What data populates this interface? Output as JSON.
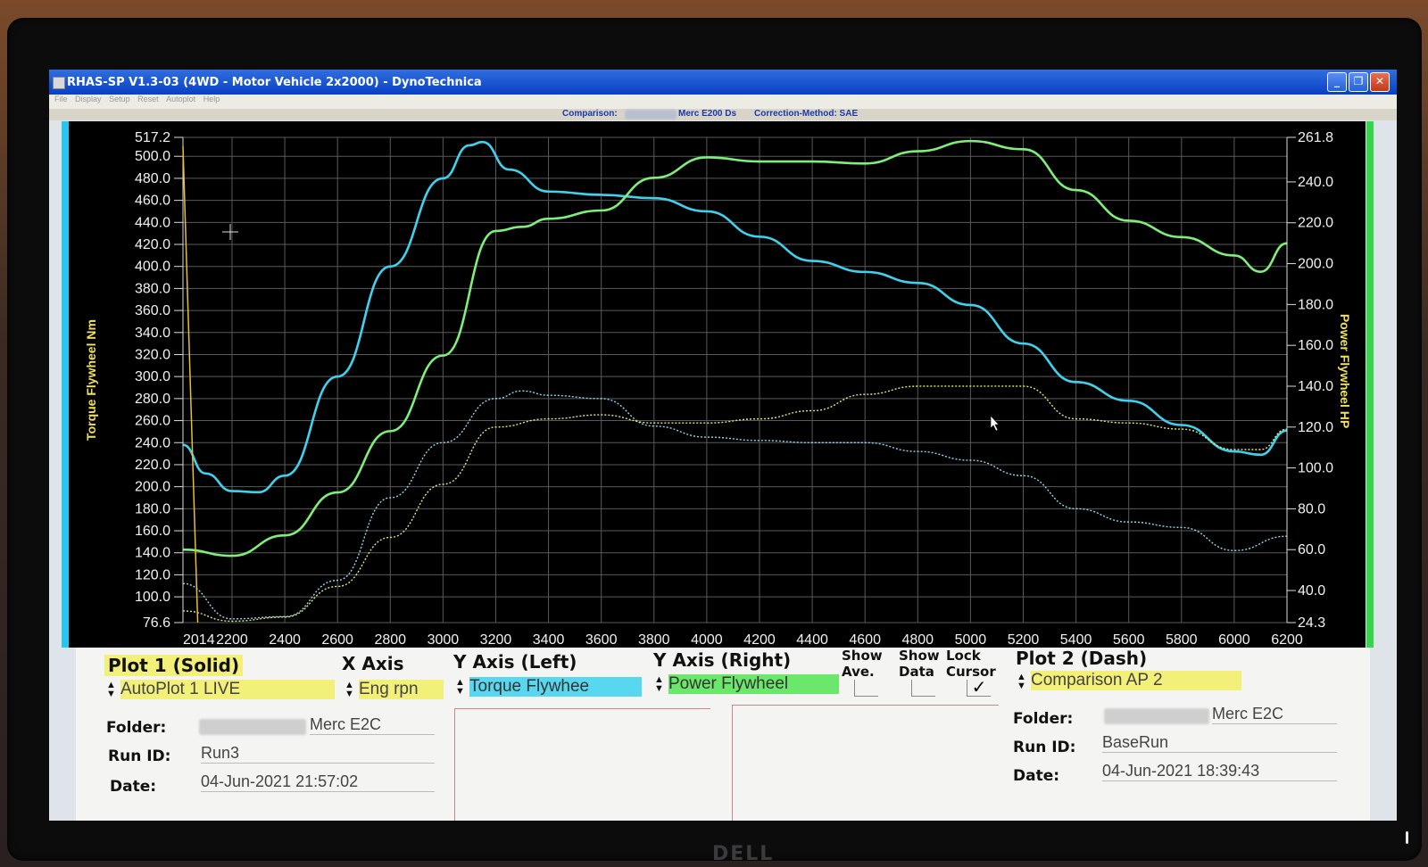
{
  "window": {
    "title": "RHAS-SP V1.3-03  (4WD - Motor Vehicle 2x2000) - DynoTechnica",
    "menu": [
      "File",
      "Display",
      "Setup",
      "Reset",
      "Autoplot",
      "Help"
    ],
    "buttons": {
      "minimize": "_",
      "restore": "❐",
      "close": "✕"
    }
  },
  "infobar": {
    "comparison_label": "Comparison:",
    "comparison_value": "Merc E200 Ds",
    "correction": "Correction-Method: SAE"
  },
  "chart_data": {
    "type": "line",
    "ylabel_left": "Torque Flywheel Nm",
    "ylabel_right": "Power Flywheel HP",
    "xlim": [
      2014,
      6200
    ],
    "ylim_left": [
      76.6,
      517.2
    ],
    "ylim_right": [
      24.3,
      261.8
    ],
    "x_ticks": [
      "2014",
      "2200",
      "2400",
      "2600",
      "2800",
      "3000",
      "3200",
      "3400",
      "3600",
      "3800",
      "4000",
      "4200",
      "4400",
      "4600",
      "4800",
      "5000",
      "5200",
      "5400",
      "5600",
      "5800",
      "6000",
      "6200"
    ],
    "y_left_ticks": [
      "517.2",
      "500.0",
      "480.0",
      "460.0",
      "440.0",
      "420.0",
      "400.0",
      "380.0",
      "360.0",
      "340.0",
      "320.0",
      "300.0",
      "280.0",
      "260.0",
      "240.0",
      "220.0",
      "200.0",
      "180.0",
      "160.0",
      "140.0",
      "120.0",
      "100.0",
      "76.6"
    ],
    "y_right_ticks": [
      "261.8",
      "240.0",
      "220.0",
      "200.0",
      "180.0",
      "160.0",
      "140.0",
      "120.0",
      "100.0",
      "80.0",
      "60.0",
      "40.0",
      "24.3"
    ],
    "grid": true,
    "series": [
      {
        "name": "Torque Flywheel",
        "plot": "AutoPlot 1 LIVE",
        "style": "solid",
        "color": "#3ed2ee",
        "x": [
          2014,
          2100,
          2200,
          2300,
          2400,
          2600,
          2800,
          3000,
          3100,
          3150,
          3250,
          3400,
          3600,
          3800,
          4000,
          4200,
          4400,
          4600,
          4800,
          5000,
          5200,
          5400,
          5600,
          5800,
          6000,
          6100,
          6200
        ],
        "y": [
          238,
          212,
          196,
          195,
          210,
          300,
          400,
          480,
          510,
          513,
          488,
          468,
          465,
          462,
          450,
          427,
          405,
          395,
          385,
          365,
          330,
          295,
          278,
          256,
          232,
          229,
          251
        ]
      },
      {
        "name": "Power Flywheel",
        "plot": "AutoPlot 1 LIVE",
        "style": "solid",
        "color": "#7ef07a",
        "x": [
          2014,
          2200,
          2400,
          2600,
          2800,
          3000,
          3200,
          3300,
          3400,
          3600,
          3800,
          4000,
          4200,
          4400,
          4600,
          4800,
          5000,
          5200,
          5400,
          5600,
          5800,
          6000,
          6100,
          6200
        ],
        "y": [
          60,
          57,
          67,
          88,
          118,
          155,
          216,
          218,
          222,
          226,
          242,
          252,
          250,
          250,
          249,
          255,
          260,
          256,
          236,
          221,
          213,
          204,
          196,
          210
        ]
      },
      {
        "name": "Torque Flywheel",
        "plot": "Comparison AP 2",
        "style": "dash",
        "color": "#8fd8ee",
        "x": [
          2014,
          2200,
          2400,
          2600,
          2800,
          3000,
          3200,
          3300,
          3400,
          3600,
          3800,
          4000,
          4200,
          4400,
          4600,
          4800,
          5000,
          5200,
          5400,
          5600,
          5800,
          6000,
          6200
        ],
        "y": [
          112,
          80,
          82,
          115,
          190,
          240,
          280,
          287,
          283,
          280,
          255,
          245,
          242,
          240,
          240,
          232,
          224,
          210,
          180,
          168,
          163,
          142,
          155
        ]
      },
      {
        "name": "Power Flywheel",
        "plot": "Comparison AP 2",
        "style": "dash",
        "color": "#e0e87a",
        "x": [
          2014,
          2200,
          2400,
          2600,
          2800,
          3000,
          3200,
          3400,
          3600,
          3800,
          4000,
          4200,
          4400,
          4600,
          4800,
          5000,
          5200,
          5400,
          5600,
          5800,
          6000,
          6100,
          6200
        ],
        "y": [
          30,
          25,
          27,
          42,
          66,
          92,
          120,
          124,
          126,
          122,
          122,
          124,
          128,
          136,
          140,
          140,
          140,
          124,
          122,
          119,
          109,
          109,
          119
        ]
      }
    ]
  },
  "controls": {
    "plot1_title": "Plot 1 (Solid)",
    "plot1_value": "AutoPlot 1 LIVE",
    "xaxis_title": "X Axis",
    "xaxis_value": "Eng rpn",
    "yleft_title": "Y Axis (Left)",
    "yleft_value": "Torque Flywhee",
    "yright_title": "Y Axis (Right)",
    "yright_value": "Power Flywheel",
    "show_ave": "Show\nAve.",
    "show_data": "Show\nData",
    "lock_cursor": "Lock\nCursor",
    "plot2_title": "Plot 2 (Dash)",
    "plot2_value": "Comparison AP 2",
    "folder_label": "Folder:",
    "runid_label": "Run ID:",
    "date_label": "Date:",
    "plot1_folder": "Merc E2C",
    "plot1_runid": "Run3",
    "plot1_date": "04-Jun-2021  21:57:02",
    "plot2_folder": "Merc E2C",
    "plot2_runid": "BaseRun",
    "plot2_date": "04-Jun-2021  18:39:43",
    "check_mark": "✓"
  },
  "bezel": {
    "brand": "DELL"
  }
}
